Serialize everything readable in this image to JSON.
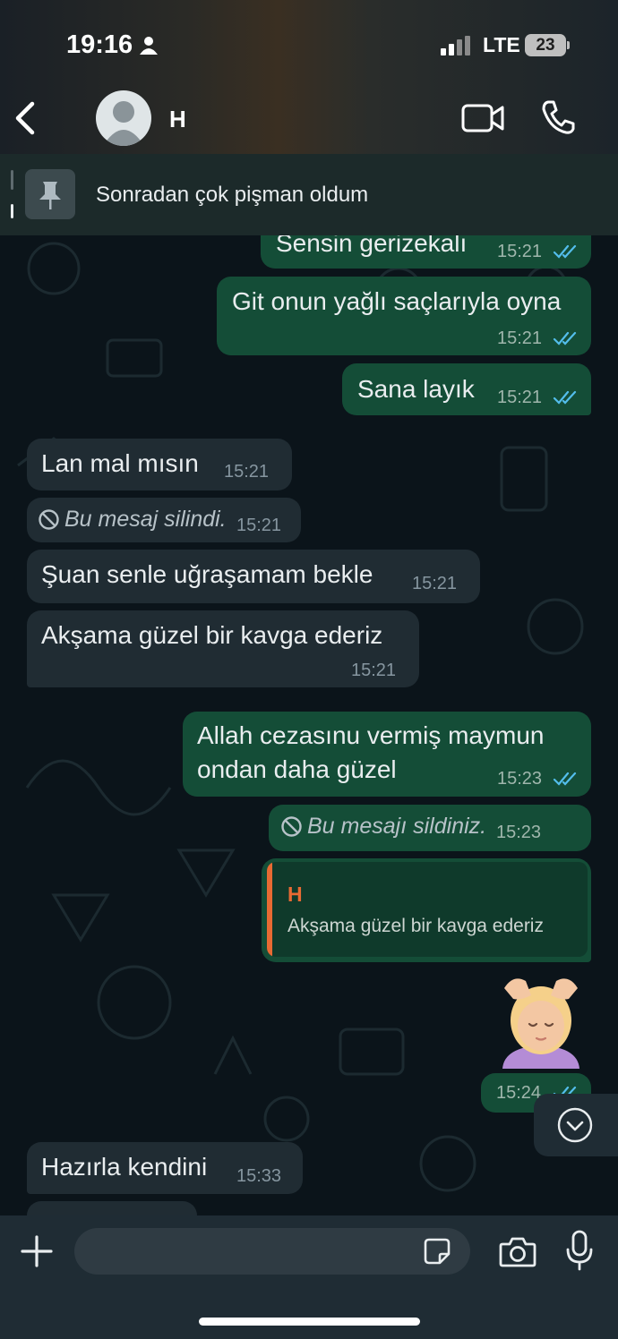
{
  "status_bar": {
    "time": "19:16",
    "network": "LTE",
    "battery": "23"
  },
  "header": {
    "contact_name": "H"
  },
  "pinned": {
    "text": "Sonradan çok pişman oldum"
  },
  "messages": [
    {
      "text": "Sensin gerizekalı",
      "time": "15:21"
    },
    {
      "text": "Git onun yağlı saçlarıyla oyna",
      "time": "15:21"
    },
    {
      "text": "Sana layık",
      "time": "15:21"
    },
    {
      "text": "Lan mal mısın",
      "time": "15:21"
    },
    {
      "text": "Bu mesaj silindi.",
      "time": "15:21"
    },
    {
      "text": "Şuan senle uğraşamam bekle",
      "time": "15:21"
    },
    {
      "text": "Akşama güzel bir kavga ederiz",
      "time": "15:21"
    },
    {
      "line1": "Allah cezasınu  vermiş maymun",
      "line2": "ondan daha güzel",
      "time": "15:23"
    },
    {
      "text": "Bu mesajı sildiniz.",
      "time": "15:23"
    },
    {
      "reply_sender": "H",
      "reply_text": "Akşama güzel bir kavga ederiz",
      "emoji": "💆‍♀️",
      "time": "15:24"
    },
    {
      "text": "Hazırla kendini",
      "time": "15:33"
    }
  ],
  "colors": {
    "outgoing_bubble": "#144d37",
    "incoming_bubble": "#202c33",
    "read_ticks": "#53bdeb",
    "reply_accent": "#e86a33"
  },
  "icons": [
    "person-icon",
    "signal-icon",
    "back-icon",
    "avatar-icon",
    "video-icon",
    "phone-icon",
    "pin-icon",
    "ban-icon",
    "chevron-down-icon",
    "plus-icon",
    "sticker-icon",
    "camera-icon",
    "mic-icon"
  ]
}
